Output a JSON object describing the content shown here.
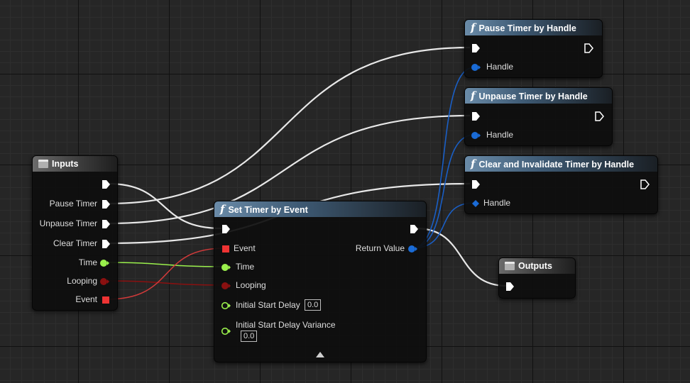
{
  "colors": {
    "exec": "#ffffff",
    "handle": "#1a6bd6",
    "bool": "#8a1010",
    "float": "#9af04c",
    "event": "#ee3333"
  },
  "nodes": {
    "pause": {
      "title": "Pause Timer by Handle",
      "icon": "function-icon",
      "handle_label": "Handle"
    },
    "unpause": {
      "title": "Unpause Timer by Handle",
      "icon": "function-icon",
      "handle_label": "Handle"
    },
    "clear": {
      "title": "Clear and Invalidate Timer by Handle",
      "icon": "function-icon",
      "handle_label": "Handle"
    },
    "inputs": {
      "title": "Inputs",
      "icon": "tunnel-icon",
      "pins": [
        "Pause Timer",
        "Unpause Timer",
        "Clear Timer",
        "Time",
        "Looping",
        "Event"
      ]
    },
    "set_timer": {
      "title": "Set Timer by Event",
      "icon": "function-icon",
      "inputs": [
        "Event",
        "Time",
        "Looping",
        "Initial Start Delay",
        "Initial Start Delay Variance"
      ],
      "initial_start_delay_value": "0.0",
      "initial_start_delay_variance_value": "0.0",
      "return_label": "Return Value"
    },
    "outputs": {
      "title": "Outputs",
      "icon": "tunnel-icon"
    }
  }
}
